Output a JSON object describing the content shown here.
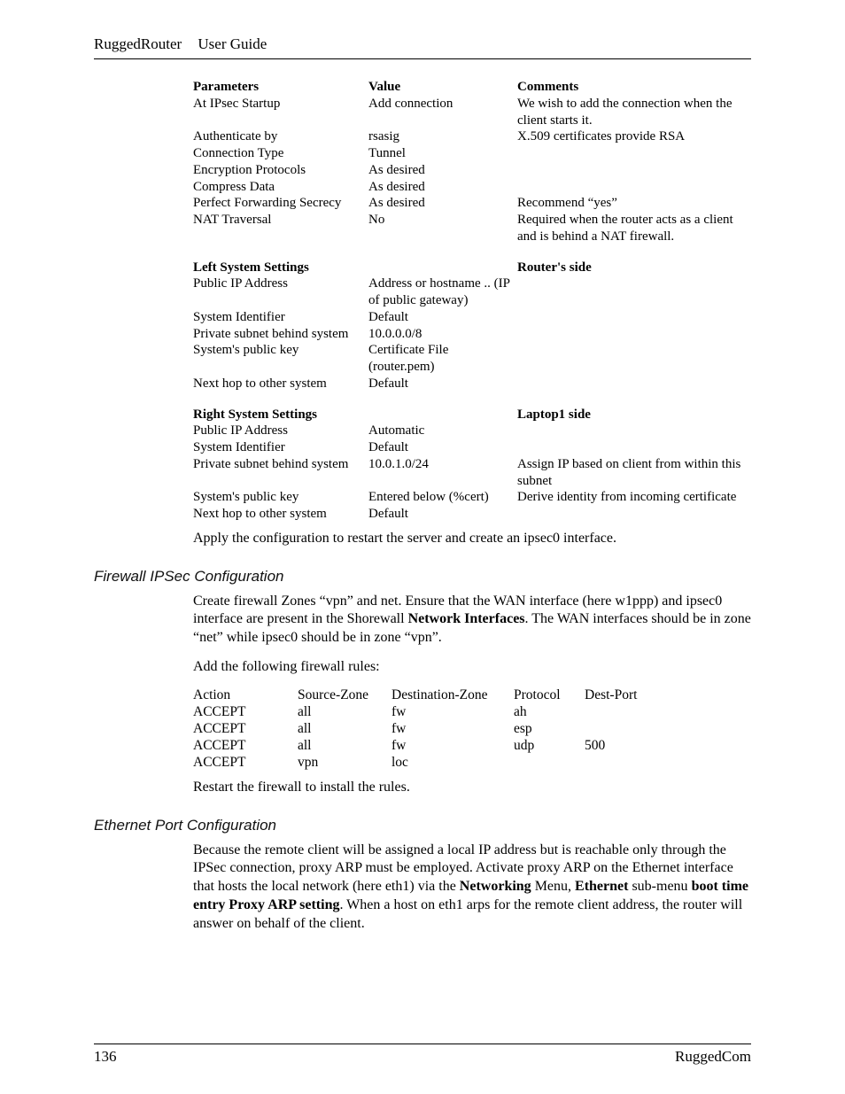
{
  "header": {
    "product": "RuggedRouter",
    "guide": "User Guide"
  },
  "table1": {
    "hdr": {
      "p": "Parameters",
      "v": "Value",
      "c": "Comments"
    },
    "rows": [
      {
        "p": "At IPsec Startup",
        "v": "Add connection",
        "c": "We wish to add the connection when the client starts it."
      },
      {
        "p": "Authenticate by",
        "v": "rsasig",
        "c": "X.509 certificates provide RSA"
      },
      {
        "p": "Connection Type",
        "v": "Tunnel",
        "c": ""
      },
      {
        "p": "Encryption Protocols",
        "v": "As desired",
        "c": ""
      },
      {
        "p": "Compress Data",
        "v": "As desired",
        "c": ""
      },
      {
        "p": "Perfect Forwarding Secrecy",
        "v": "As desired",
        "c": "Recommend “yes”"
      },
      {
        "p": "NAT Traversal",
        "v": "No",
        "c": "Required when the router acts as a client and is behind a NAT firewall."
      }
    ],
    "left": {
      "hdr": {
        "p": "Left System Settings",
        "c": "Router's side"
      },
      "rows": [
        {
          "p": "Public IP Address",
          "v": "Address or hostname .. (IP of public gateway)",
          "c": ""
        },
        {
          "p": "System Identifier",
          "v": "Default",
          "c": ""
        },
        {
          "p": "Private subnet behind system",
          "v": "10.0.0.0/8",
          "c": ""
        },
        {
          "p": "System's public key",
          "v": "Certificate File (router.pem)",
          "c": ""
        },
        {
          "p": "Next hop to other system",
          "v": "Default",
          "c": ""
        }
      ]
    },
    "right": {
      "hdr": {
        "p": "Right System Settings",
        "c": "Laptop1 side"
      },
      "rows": [
        {
          "p": "Public IP Address",
          "v": "Automatic",
          "c": ""
        },
        {
          "p": "System Identifier",
          "v": "Default",
          "c": ""
        },
        {
          "p": "Private subnet behind system",
          "v": "10.0.1.0/24",
          "c": "Assign IP based on client from within this subnet"
        },
        {
          "p": "System's public key",
          "v": "Entered below (%cert)",
          "c": "Derive identity from incoming certificate"
        },
        {
          "p": "Next hop to other system",
          "v": "Default",
          "c": ""
        }
      ]
    }
  },
  "apply_para": "Apply the configuration to restart the server and create an ipsec0 interface.",
  "firewall": {
    "heading": "Firewall IPSec Configuration",
    "p1a": "Create firewall Zones “vpn” and net.  Ensure that the WAN interface (here w1ppp) and ipsec0 interface are present in the Shorewall ",
    "p1b": "Network Interfaces",
    "p1c": ".  The WAN interfaces should be in zone “net” while ipsec0 should be in zone “vpn”.",
    "p2": "Add the following firewall rules:",
    "hdr": {
      "a": "Action",
      "s": "Source-Zone",
      "d": "Destination-Zone",
      "pr": "Protocol",
      "dp": "Dest-Port"
    },
    "rows": [
      {
        "a": "ACCEPT",
        "s": "all",
        "d": "fw",
        "pr": "ah",
        "dp": ""
      },
      {
        "a": "ACCEPT",
        "s": "all",
        "d": "fw",
        "pr": "esp",
        "dp": ""
      },
      {
        "a": "ACCEPT",
        "s": "all",
        "d": "fw",
        "pr": "udp",
        "dp": "500"
      },
      {
        "a": "ACCEPT",
        "s": "vpn",
        "d": "loc",
        "pr": "",
        "dp": ""
      }
    ],
    "p3": "Restart the firewall to install the rules."
  },
  "eth": {
    "heading": "Ethernet Port Configuration",
    "p1a": "Because the remote client will be assigned a local IP address but is reachable only through the IPSec connection, proxy ARP must be employed.  Activate proxy ARP on the Ethernet interface that hosts the local network (here eth1) via the ",
    "p1b": "Networking",
    "p1c": " Menu, ",
    "p1d": "Ethernet",
    "p1e": " sub-menu ",
    "p1f": "boot time entry Proxy ARP setting",
    "p1g": ".  When a host on eth1 arps for the remote client address, the router will answer on behalf of the client."
  },
  "footer": {
    "page": "136",
    "brand": "RuggedCom"
  }
}
